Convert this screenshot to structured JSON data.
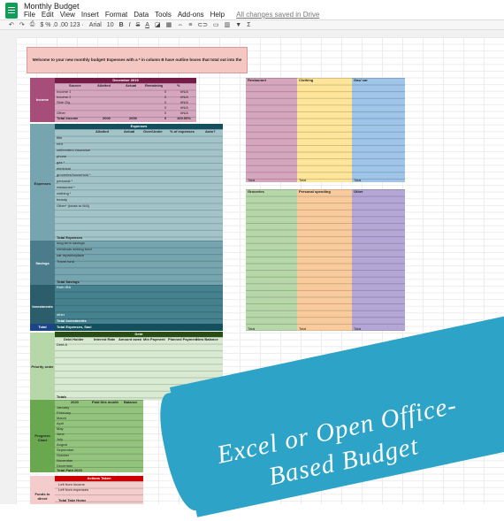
{
  "doc": {
    "title": "Monthly Budget",
    "saved": "All changes saved in Drive"
  },
  "menu": [
    "File",
    "Edit",
    "View",
    "Insert",
    "Format",
    "Data",
    "Tools",
    "Add-ons",
    "Help"
  ],
  "toolbar": {
    "zoom": "$  %  .0  .00  123 ·",
    "font": "Arial",
    "size": "10",
    "b": "B",
    "i": "I",
    "s": "S",
    "a": "A"
  },
  "welcome": "Welcome to your new monthly budget! Expenses with a * in column B have outline boxes that total out into the actual box.",
  "income": {
    "section": "Income",
    "title": "December 2019",
    "headers": [
      "Source",
      "Allotted",
      "Actual",
      "Remaining",
      "%"
    ],
    "rows": [
      [
        "Income 1",
        "",
        "",
        "0",
        "#N/A"
      ],
      [
        "Income 2",
        "",
        "",
        "0",
        "#N/A"
      ],
      [
        "Side Gig",
        "",
        "",
        "0",
        "#N/A"
      ],
      [
        "",
        "",
        "",
        "0",
        "#N/A"
      ],
      [
        "Other",
        "",
        "",
        "0",
        "#N/A"
      ]
    ],
    "total": [
      "Total Income",
      "2000",
      "2000",
      "0",
      "100.00%"
    ]
  },
  "expenses": {
    "section": "Expenses",
    "title": "Expenses",
    "headers": [
      "",
      "Allotted",
      "Actual",
      "Over/Under",
      "% of expenses",
      "Auto?"
    ],
    "rows": [
      "title",
      "rent",
      "cell/renters insurance",
      "phone",
      "gas *",
      "electrical",
      "groceries/household *",
      "personal *",
      "restaurant *",
      "clothing *",
      "beauty",
      "Other* (totals to N/A)",
      "",
      "",
      "",
      "",
      ""
    ],
    "total": "Total Expenses"
  },
  "savings": {
    "section": "Savings",
    "rows": [
      "long-term savings",
      "christmas sinking fund",
      "car repair/replace",
      "Travel fund",
      ""
    ],
    "total": "Total Savings"
  },
  "investments": {
    "section": "Investments",
    "rows": [
      "Roth IRA",
      "",
      "",
      "",
      "other"
    ],
    "total": "Total Investments"
  },
  "total": {
    "section": "Total",
    "row": "Total Expenses, Savi"
  },
  "debt": {
    "section": "Priority order",
    "title": "Debt",
    "headers": [
      "Debt Holder",
      "Interest Rate",
      "Amount owed",
      "Min Payment",
      "Planned Payment",
      "New Balance"
    ],
    "first": "Debt A",
    "total": "Totals"
  },
  "progress": {
    "section": "Progress Chart",
    "headers": [
      "2020",
      "Paid this month",
      "Balance"
    ],
    "months": [
      "January",
      "February",
      "March",
      "April",
      "May",
      "June",
      "July",
      "August",
      "September",
      "October",
      "November",
      "December"
    ],
    "total": "Total Paid 2020"
  },
  "funds": {
    "section": "Funds to direct",
    "title": "Actions Taken",
    "rows": [
      "Left from income",
      "Left from expenses"
    ],
    "total": "Total Take Home"
  },
  "categories": [
    {
      "name": "Restaurant",
      "color": "#d5a6bd"
    },
    {
      "name": "Clothing",
      "color": "#ffe599"
    },
    {
      "name": "Gas/ car",
      "color": "#9fc5e8"
    },
    {
      "name": "Groceries",
      "color": "#b6d7a8"
    },
    {
      "name": "Personal spending",
      "color": "#f9cb9c"
    },
    {
      "name": "Other",
      "color": "#b4a7d6"
    }
  ],
  "cat_total": "Total",
  "banner": {
    "line1": "Excel or Open Office-",
    "line2": "Based Budget"
  },
  "colors": {
    "income": "#a64d79",
    "expenses": "#45818e",
    "savings": "#4a7c8c",
    "invest": "#2b5d6b",
    "debt": "#38761d",
    "progress": "#6aa84f",
    "funds": "#cc0000",
    "banner": "#2ca3c7"
  }
}
